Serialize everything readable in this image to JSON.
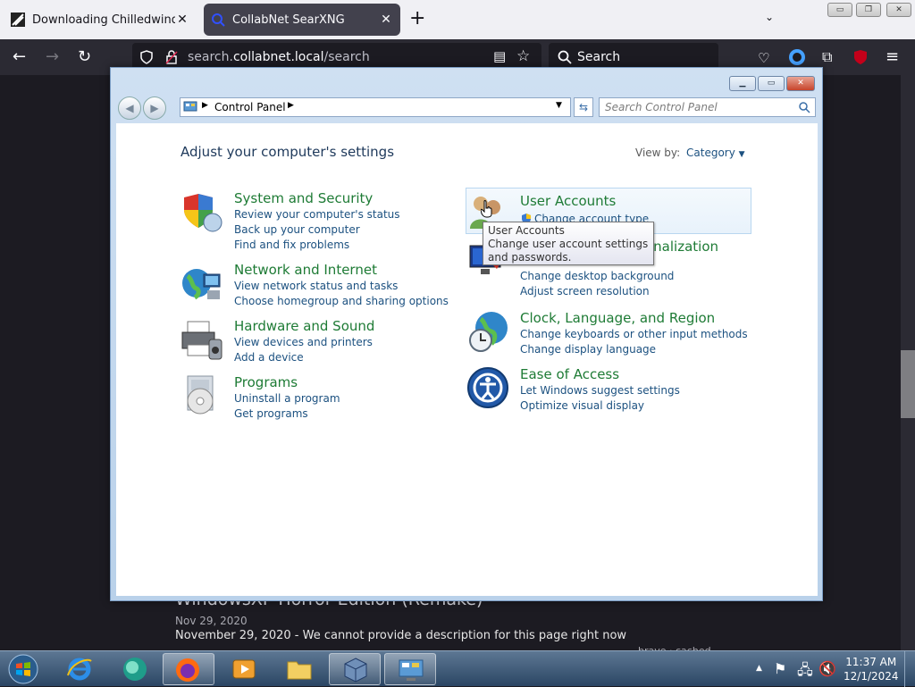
{
  "browser": {
    "tabs": [
      {
        "title": "Downloading Chilledwindows.exe",
        "close": "✕"
      },
      {
        "title": "CollabNet SearXNG",
        "close": "✕"
      }
    ],
    "new_tab": "+",
    "tab_list": "⌄",
    "url_prefix": "search.",
    "url_domain": "collabnet.local",
    "url_path": "/search",
    "search_placeholder": "Search",
    "window_buttons": [
      "▭",
      "❐",
      "✕"
    ]
  },
  "page": {
    "result_title": "WindowsXP Horror Edition (Remake)",
    "result_date": "Nov 29, 2020",
    "result_desc": "November 29, 2020 - We cannot provide a description for this page right now",
    "result_meta": "brave  ·  cached"
  },
  "control_panel": {
    "window_buttons": [
      "▁",
      "▭",
      "✕"
    ],
    "breadcrumb_root": "Control Panel",
    "search_placeholder": "Search Control Panel",
    "heading": "Adjust your computer's settings",
    "view_by_label": "View by:",
    "view_by_value": "Category",
    "categories_left": [
      {
        "title": "System and Security",
        "links": [
          "Review your computer's status",
          "Back up your computer",
          "Find and fix problems"
        ],
        "icon": "shield-icon"
      },
      {
        "title": "Network and Internet",
        "links": [
          "View network status and tasks",
          "Choose homegroup and sharing options"
        ],
        "icon": "network-globe-icon"
      },
      {
        "title": "Hardware and Sound",
        "links": [
          "View devices and printers",
          "Add a device"
        ],
        "icon": "printer-icon"
      },
      {
        "title": "Programs",
        "links": [
          "Uninstall a program",
          "Get programs"
        ],
        "icon": "programs-disc-icon"
      }
    ],
    "categories_right": [
      {
        "title": "User Accounts",
        "links": [
          "Change account type"
        ],
        "icon": "users-icon"
      },
      {
        "title": "Appearance and Personalization",
        "title_visible": "onalization",
        "links": [
          "Change desktop background",
          "Adjust screen resolution"
        ],
        "icon": "monitor-paint-icon"
      },
      {
        "title": "Clock, Language, and Region",
        "links": [
          "Change keyboards or other input methods",
          "Change display language"
        ],
        "icon": "clock-globe-icon"
      },
      {
        "title": "Ease of Access",
        "links": [
          "Let Windows suggest settings",
          "Optimize visual display"
        ],
        "icon": "ease-of-access-icon"
      }
    ],
    "tooltip": {
      "title": "User Accounts",
      "body": "Change user account settings and passwords."
    }
  },
  "taskbar": {
    "time": "11:37 AM",
    "date": "12/1/2024",
    "tray_arrow": "▲"
  }
}
